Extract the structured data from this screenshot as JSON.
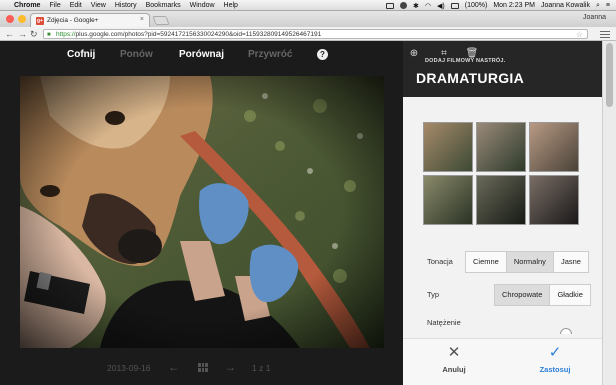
{
  "menubar": {
    "app": "Chrome",
    "items": [
      "File",
      "Edit",
      "View",
      "History",
      "Bookmarks",
      "Window",
      "Help"
    ],
    "battery": "(100%)",
    "clock": "Mon 2:23 PM",
    "user": "Joanna Kowalik"
  },
  "browser": {
    "tab_title": "Zdjęcia - Google+",
    "tab_favicon": "g+",
    "url_scheme": "https://",
    "url_rest": "plus.google.com/photos?pid=5924172156330024290&oid=115932809149526467191",
    "window_user": "Joanna"
  },
  "editor": {
    "toolbar": {
      "undo": "Cofnij",
      "redo": "Ponów",
      "compare": "Porównaj",
      "revert": "Przywróć",
      "help": "?"
    },
    "footer": {
      "date": "2013-09-16",
      "counter": "1 z 1"
    }
  },
  "panel": {
    "tool_caption": "DODAJ FILMOWY NASTRÓJ.",
    "title": "DRAMATURGIA",
    "tone": {
      "label": "Tonacja",
      "options": [
        "Ciemne",
        "Normalny",
        "Jasne"
      ],
      "selected": "Normalny"
    },
    "type": {
      "label": "Typ",
      "options": [
        "Chropowate",
        "Gładkie"
      ],
      "selected": "Chropowate"
    },
    "strength_label": "Natężenie",
    "cancel": "Anuluj",
    "apply": "Zastosuj"
  },
  "colors": {
    "apply_blue": "#2c7ed6",
    "panel_header": "#262626"
  }
}
